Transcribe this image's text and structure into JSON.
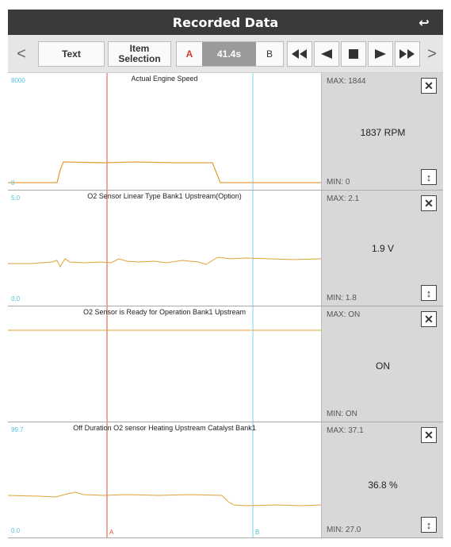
{
  "header": {
    "title": "Recorded Data",
    "back_icon": "back-arrow-icon"
  },
  "toolbar": {
    "prev_label": "<",
    "next_label": ">",
    "text_label": "Text",
    "item_selection_label": "Item Selection",
    "a_label": "A",
    "time_value": "41.4s",
    "b_label": "B"
  },
  "cursors": {
    "a_label": "A",
    "b_label": "B",
    "a_color": "#d9533f",
    "b_color": "#7fd0e0"
  },
  "panels": [
    {
      "title": "Actual Engine Speed",
      "ymax": "8000",
      "ymin": "0",
      "max": "MAX: 1844",
      "min": "MIN: 0",
      "value": "1837 RPM"
    },
    {
      "title": "O2 Sensor Linear Type Bank1 Upstream(Option)",
      "ymax": "5.0",
      "ymin": "0.0",
      "max": "MAX: 2.1",
      "min": "MIN: 1.8",
      "value": "1.9 V"
    },
    {
      "title": "O2 Sensor is Ready for Operation Bank1 Upstream",
      "ymax": "",
      "ymin": "",
      "max": "MAX: ON",
      "min": "MIN: ON",
      "value": "ON"
    },
    {
      "title": "Off Duration O2 sensor Heating Upstream Catalyst Bank1",
      "ymax": "99.7",
      "ymin": "0.0",
      "max": "MAX: 37.1",
      "min": "MIN: 27.0",
      "value": "36.8 %"
    }
  ],
  "colors": {
    "trace": "#e0a23a",
    "accent": "#4fc3d8",
    "header_bg": "#3a3a3a",
    "side_bg": "#d8d8d8"
  }
}
